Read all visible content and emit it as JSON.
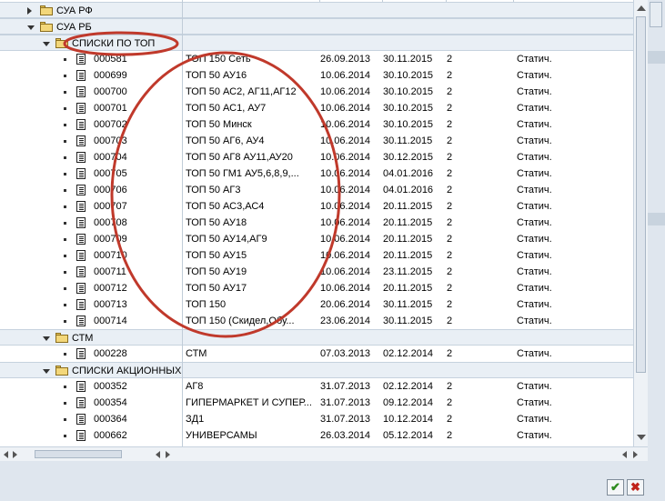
{
  "tree": {
    "rows": [
      {
        "type": "folder",
        "level": 1,
        "expanded": false,
        "label": "СУА РФ"
      },
      {
        "type": "folder",
        "level": 1,
        "expanded": true,
        "label": "СУА РБ"
      },
      {
        "type": "folder",
        "level": 2,
        "expanded": true,
        "label": "СПИСКИ ПО ТОП"
      },
      {
        "type": "item",
        "id": "000581",
        "desc": "ТОП 150 Сеть",
        "date_from": "26.09.2013",
        "date_to": "30.11.2015",
        "num": "2",
        "kind": "Статич."
      },
      {
        "type": "item",
        "id": "000699",
        "desc": "ТОП 50 АУ16",
        "date_from": "10.06.2014",
        "date_to": "30.10.2015",
        "num": "2",
        "kind": "Статич."
      },
      {
        "type": "item",
        "id": "000700",
        "desc": "ТОП 50 АС2, АГ11,АГ12",
        "date_from": "10.06.2014",
        "date_to": "30.10.2015",
        "num": "2",
        "kind": "Статич."
      },
      {
        "type": "item",
        "id": "000701",
        "desc": "ТОП 50 АС1, АУ7",
        "date_from": "10.06.2014",
        "date_to": "30.10.2015",
        "num": "2",
        "kind": "Статич."
      },
      {
        "type": "item",
        "id": "000702",
        "desc": "ТОП 50 Минск",
        "date_from": "10.06.2014",
        "date_to": "30.10.2015",
        "num": "2",
        "kind": "Статич."
      },
      {
        "type": "item",
        "id": "000703",
        "desc": "ТОП 50 АГ6, АУ4",
        "date_from": "10.06.2014",
        "date_to": "30.11.2015",
        "num": "2",
        "kind": "Статич."
      },
      {
        "type": "item",
        "id": "000704",
        "desc": "ТОП 50 АГ8 АУ11,АУ20",
        "date_from": "10.06.2014",
        "date_to": "30.12.2015",
        "num": "2",
        "kind": "Статич."
      },
      {
        "type": "item",
        "id": "000705",
        "desc": "ТОП 50 ГМ1 АУ5,6,8,9,...",
        "date_from": "10.06.2014",
        "date_to": "04.01.2016",
        "num": "2",
        "kind": "Статич."
      },
      {
        "type": "item",
        "id": "000706",
        "desc": "ТОП 50 АГ3",
        "date_from": "10.06.2014",
        "date_to": "04.01.2016",
        "num": "2",
        "kind": "Статич."
      },
      {
        "type": "item",
        "id": "000707",
        "desc": "ТОП 50 АС3,АС4",
        "date_from": "10.06.2014",
        "date_to": "20.11.2015",
        "num": "2",
        "kind": "Статич."
      },
      {
        "type": "item",
        "id": "000708",
        "desc": "ТОП 50 АУ18",
        "date_from": "10.06.2014",
        "date_to": "20.11.2015",
        "num": "2",
        "kind": "Статич."
      },
      {
        "type": "item",
        "id": "000709",
        "desc": "ТОП 50 АУ14,АГ9",
        "date_from": "10.06.2014",
        "date_to": "20.11.2015",
        "num": "2",
        "kind": "Статич."
      },
      {
        "type": "item",
        "id": "000710",
        "desc": "ТОП 50 АУ15",
        "date_from": "10.06.2014",
        "date_to": "20.11.2015",
        "num": "2",
        "kind": "Статич."
      },
      {
        "type": "item",
        "id": "000711",
        "desc": "ТОП 50 АУ19",
        "date_from": "10.06.2014",
        "date_to": "23.11.2015",
        "num": "2",
        "kind": "Статич."
      },
      {
        "type": "item",
        "id": "000712",
        "desc": "ТОП 50 АУ17",
        "date_from": "10.06.2014",
        "date_to": "20.11.2015",
        "num": "2",
        "kind": "Статич."
      },
      {
        "type": "item",
        "id": "000713",
        "desc": "ТОП 150",
        "date_from": "20.06.2014",
        "date_to": "30.11.2015",
        "num": "2",
        "kind": "Статич."
      },
      {
        "type": "item",
        "id": "000714",
        "desc": "ТОП 150 (Скидел,Обу...",
        "date_from": "23.06.2014",
        "date_to": "30.11.2015",
        "num": "2",
        "kind": "Статич."
      },
      {
        "type": "folder",
        "level": 2,
        "expanded": true,
        "label": "СТМ"
      },
      {
        "type": "item",
        "id": "000228",
        "desc": "СТМ",
        "date_from": "07.03.2013",
        "date_to": "02.12.2014",
        "num": "2",
        "kind": "Статич."
      },
      {
        "type": "folder",
        "level": 2,
        "expanded": true,
        "label": "СПИСКИ АКЦИОННЫХ"
      },
      {
        "type": "item",
        "id": "000352",
        "desc": "АГ8",
        "date_from": "31.07.2013",
        "date_to": "02.12.2014",
        "num": "2",
        "kind": "Статич."
      },
      {
        "type": "item",
        "id": "000354",
        "desc": "ГИПЕРМАРКЕТ И СУПЕР...",
        "date_from": "31.07.2013",
        "date_to": "09.12.2014",
        "num": "2",
        "kind": "Статич."
      },
      {
        "type": "item",
        "id": "000364",
        "desc": "ЗД1",
        "date_from": "31.07.2013",
        "date_to": "10.12.2014",
        "num": "2",
        "kind": "Статич."
      },
      {
        "type": "item",
        "id": "000662",
        "desc": "УНИВЕРСАМЫ",
        "date_from": "26.03.2014",
        "date_to": "05.12.2014",
        "num": "2",
        "kind": "Статич."
      }
    ]
  },
  "buttons": {
    "ok": "✔",
    "cancel": "✖"
  },
  "colors": {
    "annotation": "#c0392b",
    "ok": "#2e8b1f",
    "cancel": "#c0221a"
  }
}
